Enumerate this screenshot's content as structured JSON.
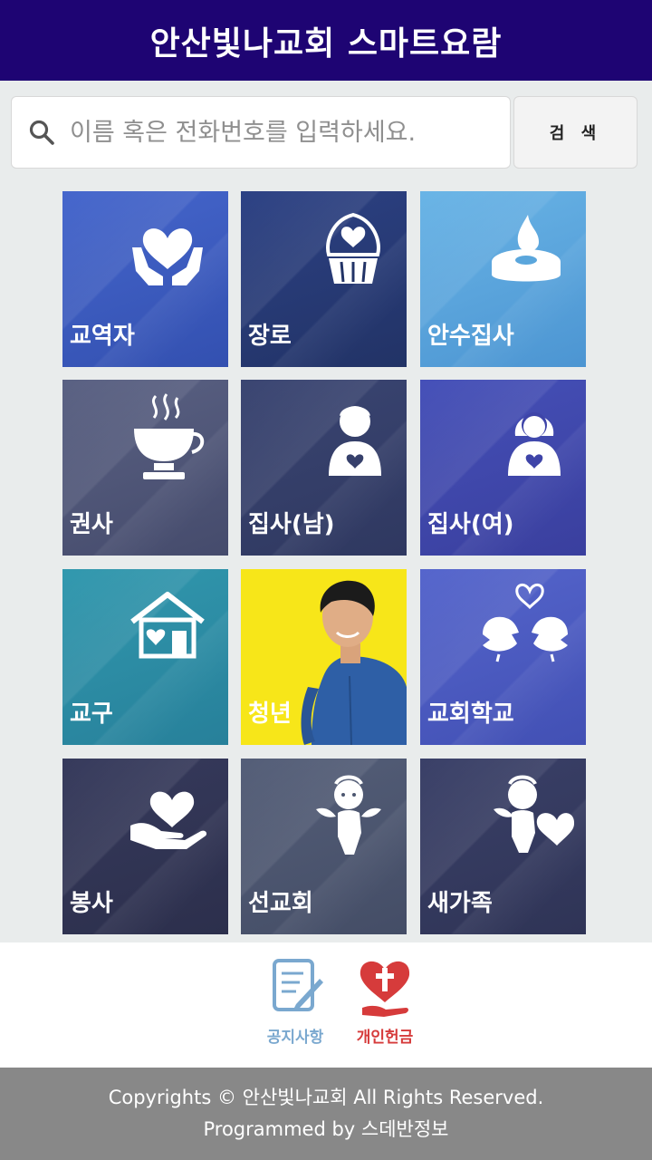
{
  "header": {
    "title": "안산빛나교회 스마트요람"
  },
  "search": {
    "placeholder": "이름 혹은 전화번호를 입력하세요.",
    "button_label": "검 색"
  },
  "tiles": [
    {
      "label": "교역자",
      "icon": "heart-hands-icon",
      "color": "#3c5bbf"
    },
    {
      "label": "장로",
      "icon": "cupcake-heart-icon",
      "color": "#283b7a"
    },
    {
      "label": "안수집사",
      "icon": "candle-icon",
      "color": "#5aa6dc"
    },
    {
      "label": "권사",
      "icon": "coffee-cup-icon",
      "color": "#4e5577"
    },
    {
      "label": "집사(남)",
      "icon": "man-heart-icon",
      "color": "#36406b"
    },
    {
      "label": "집사(여)",
      "icon": "woman-heart-icon",
      "color": "#3e44a8"
    },
    {
      "label": "교구",
      "icon": "house-heart-icon",
      "color": "#2f8ea6"
    },
    {
      "label": "청년",
      "icon": "young-man-photo",
      "color": "#f7e619"
    },
    {
      "label": "교회학교",
      "icon": "love-birds-icon",
      "color": "#4a59bf"
    },
    {
      "label": "봉사",
      "icon": "heart-hand-icon",
      "color": "#313454"
    },
    {
      "label": "선교회",
      "icon": "cupid-icon",
      "color": "#4c566f"
    },
    {
      "label": "새가족",
      "icon": "cupid-heart-icon",
      "color": "#363c5f"
    }
  ],
  "bottom_nav": [
    {
      "label": "공지사항",
      "icon": "notice-clipboard-icon",
      "color": "#7aa8cf"
    },
    {
      "label": "개인헌금",
      "icon": "offering-heart-cross-icon",
      "color": "#d63b3b"
    }
  ],
  "footer": {
    "copyright": "Copyrights © 안산빛나교회 All Rights Reserved.",
    "programmed": "Programmed by 스데반정보"
  }
}
